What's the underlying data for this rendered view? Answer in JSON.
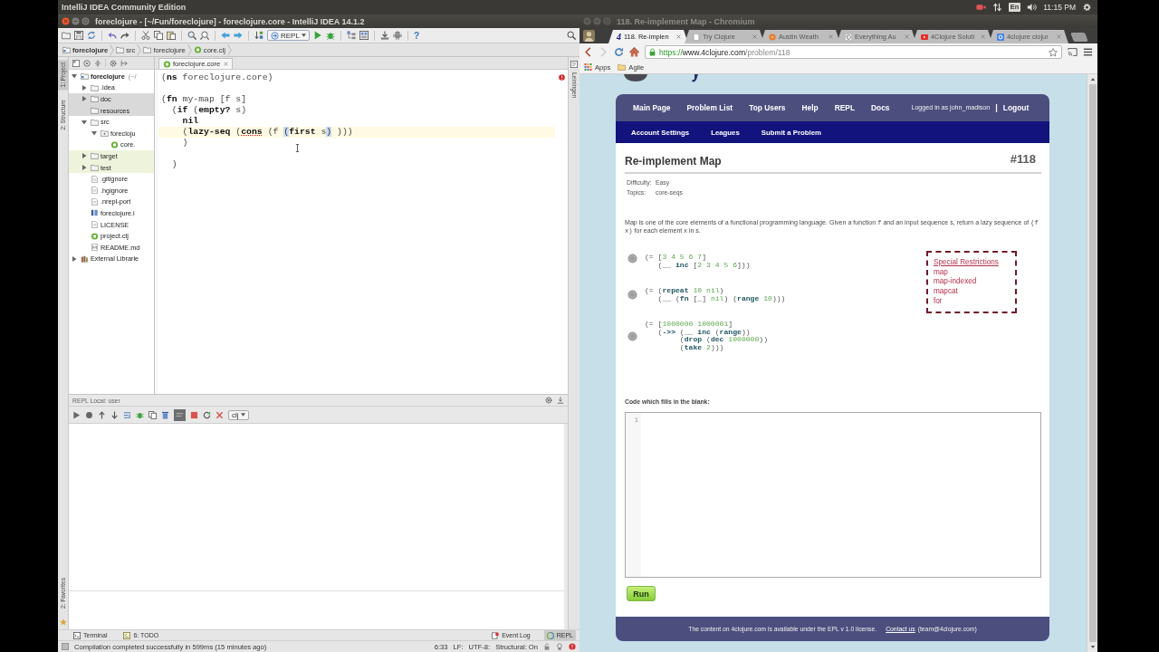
{
  "desktop_bar": {
    "app_name": "IntelliJ IDEA Community Edition",
    "keyboard_layout": "En",
    "clock": "11:15 PM"
  },
  "ide": {
    "title": "foreclojure - [~/Fun/foreclojure] - foreclojure.core - IntelliJ IDEA 14.1.2",
    "run_config": "REPL",
    "help": "?",
    "breadcrumbs": [
      {
        "label": "foreclojure",
        "kind": "project"
      },
      {
        "label": "src",
        "kind": "folder"
      },
      {
        "label": "foreclojure",
        "kind": "folder"
      },
      {
        "label": "core.clj",
        "kind": "clj"
      }
    ],
    "left_stripe": [
      {
        "label": "1: Project",
        "selected": true
      },
      {
        "label": "2: Structure",
        "selected": false
      }
    ],
    "favorites_tab": {
      "label": "2: Favorites"
    },
    "right_stripe": {
      "label": "Leiningen"
    },
    "project_tree": [
      {
        "label": "foreclojure",
        "note": "(~/",
        "kind": "project",
        "expanded": true,
        "children": [
          {
            "label": ".idea",
            "kind": "folder",
            "expanded": false
          },
          {
            "label": "doc",
            "kind": "folder",
            "expanded": false,
            "color": "#d9d9d9"
          },
          {
            "label": "resources",
            "kind": "folder",
            "color": "#d9d9d9"
          },
          {
            "label": "src",
            "kind": "folder",
            "expanded": true,
            "children": [
              {
                "label": "forecloju",
                "kind": "package",
                "expanded": true,
                "children": [
                  {
                    "label": "core.",
                    "kind": "clj"
                  }
                ]
              }
            ]
          },
          {
            "label": "target",
            "kind": "folder",
            "expanded": false,
            "color": "#eef4dc"
          },
          {
            "label": "test",
            "kind": "folder",
            "expanded": false,
            "color": "#eef4dc"
          },
          {
            "label": ".gitignore",
            "kind": "file"
          },
          {
            "label": ".hgignore",
            "kind": "file"
          },
          {
            "label": ".nrepl-port",
            "kind": "file"
          },
          {
            "label": "foreclojure.i",
            "kind": "module"
          },
          {
            "label": "LICENSE",
            "kind": "file"
          },
          {
            "label": "project.clj",
            "kind": "clj"
          },
          {
            "label": "README.md",
            "kind": "markdown"
          }
        ]
      },
      {
        "label": "External Librarie",
        "kind": "library",
        "expanded": false
      }
    ],
    "editor_tab": {
      "label": "foreclojure.core"
    },
    "code_lines": [
      {
        "current": false,
        "tokens": [
          {
            "text": "(",
            "kind": "plain"
          },
          {
            "text": "ns",
            "kind": "keyword"
          },
          {
            "text": " foreclojure.core)",
            "kind": "plain"
          }
        ]
      },
      {
        "current": false
      },
      {
        "current": false,
        "tokens": [
          {
            "text": "(",
            "kind": "plain"
          },
          {
            "text": "fn",
            "kind": "keyword"
          },
          {
            "text": " my-map [f s]",
            "kind": "plain"
          }
        ]
      },
      {
        "current": false,
        "tokens": [
          {
            "text": "  (",
            "kind": "plain"
          },
          {
            "text": "if",
            "kind": "keyword"
          },
          {
            "text": " (",
            "kind": "plain"
          },
          {
            "text": "empty?",
            "kind": "keyword"
          },
          {
            "text": " s)",
            "kind": "plain"
          }
        ]
      },
      {
        "current": false,
        "tokens": [
          {
            "text": "    nil",
            "kind": "keyword"
          }
        ]
      },
      {
        "current": true,
        "tokens": [
          {
            "text": "    (",
            "kind": "plain"
          },
          {
            "text": "lazy-seq",
            "kind": "keyword"
          },
          {
            "text": " (",
            "kind": "plain"
          },
          {
            "text": "cons",
            "kind": "keyword-flagged"
          },
          {
            "text": " (f ",
            "kind": "plain"
          },
          {
            "text": "(",
            "kind": "match"
          },
          {
            "text": "first",
            "kind": "keyword"
          },
          {
            "text": " s",
            "kind": "plain"
          },
          {
            "text": ")",
            "kind": "match"
          },
          {
            "text": " )))",
            "kind": "plain"
          }
        ]
      },
      {
        "current": false,
        "tokens": [
          {
            "text": "    )",
            "kind": "plain"
          }
        ]
      },
      {
        "current": false
      },
      {
        "current": false,
        "tokens": [
          {
            "text": "  )",
            "kind": "plain"
          }
        ]
      }
    ],
    "repl": {
      "title": "REPL Local: user",
      "toggle_on": true,
      "language": "clj"
    },
    "bottom_tabs": [
      {
        "label": "Terminal",
        "kind": "terminal",
        "selected": false
      },
      {
        "label": "6: TODO",
        "kind": "todo",
        "selected": false
      }
    ],
    "bottom_tabs_right": [
      {
        "label": "Event Log",
        "kind": "log",
        "selected": false
      },
      {
        "label": "REPL",
        "kind": "repl",
        "selected": true
      }
    ],
    "status_bar": {
      "message": "Compilation completed successfully in 599ms (15 minutes ago)",
      "position": "6:33",
      "line_separator": "LF:",
      "encoding": "UTF-8:",
      "structural": "Structural: On"
    }
  },
  "browser": {
    "title": "118. Re-implement Map - Chromium",
    "tabs": [
      {
        "label": "118. Re-implen",
        "kind": "glyph",
        "glyph": "4",
        "selected": true
      },
      {
        "label": "Try Clojure",
        "kind": "page",
        "selected": false
      },
      {
        "label": "Austin Weath",
        "kind": "dot",
        "selected": false
      },
      {
        "label": "Everything Au",
        "kind": "swirl",
        "selected": false
      },
      {
        "label": "4Clojure Soluti",
        "kind": "video",
        "selected": false
      },
      {
        "label": "4clojure clojur",
        "kind": "search",
        "selected": false
      }
    ],
    "url": {
      "scheme": "https://",
      "host": "www.4clojure.com",
      "path": "/problem/118"
    },
    "bookmarks": [
      {
        "label": "Apps",
        "kind": "apps"
      },
      {
        "label": "Agile",
        "kind": "folder"
      }
    ],
    "page": {
      "nav": [
        "Main Page",
        "Problem List",
        "Top Users",
        "Help",
        "REPL",
        "Docs"
      ],
      "login_status": "Logged in as john_madison",
      "separator": "|",
      "logout": "Logout",
      "subnav": [
        "Account Settings",
        "Leagues",
        "Submit a Problem"
      ],
      "problem": {
        "title": "Re-implement Map",
        "number": "#118",
        "meta": [
          {
            "label": "Difficulty:",
            "value": "Easy"
          },
          {
            "label": "Topics:",
            "value": "core-seqs"
          }
        ],
        "description": [
          {
            "text": "Map is one of the core elements of a functional programming language. Given a function ",
            "kind": "text"
          },
          {
            "text": "f",
            "kind": "code"
          },
          {
            "text": " and an input sequence s, return a lazy sequence of ",
            "kind": "text"
          },
          {
            "text": "(f x)",
            "kind": "code"
          },
          {
            "text": " for each element x in s.",
            "kind": "text"
          }
        ],
        "tests": [
          {
            "passed": false,
            "lines": [
              {
                "tokens": [
                  {
                    "text": "(= [",
                    "kind": "plain"
                  },
                  {
                    "text": "3 4 5 6 7",
                    "kind": "literal"
                  },
                  {
                    "text": "]",
                    "kind": "plain"
                  }
                ]
              },
              {
                "tokens": [
                  {
                    "text": "   (__ ",
                    "kind": "plain"
                  },
                  {
                    "text": "inc",
                    "kind": "keyword"
                  },
                  {
                    "text": " [",
                    "kind": "plain"
                  },
                  {
                    "text": "2 3 4 5 6",
                    "kind": "literal"
                  },
                  {
                    "text": "]))",
                    "kind": "plain"
                  }
                ]
              }
            ]
          },
          {
            "passed": false,
            "lines": [
              {
                "tokens": [
                  {
                    "text": "(= (",
                    "kind": "plain"
                  },
                  {
                    "text": "repeat",
                    "kind": "keyword"
                  },
                  {
                    "text": " 10 nil",
                    "kind": "literal"
                  },
                  {
                    "text": ")",
                    "kind": "plain"
                  }
                ]
              },
              {
                "tokens": [
                  {
                    "text": "   (__ (",
                    "kind": "plain"
                  },
                  {
                    "text": "fn",
                    "kind": "keyword"
                  },
                  {
                    "text": " [_] ",
                    "kind": "plain"
                  },
                  {
                    "text": "nil",
                    "kind": "literal"
                  },
                  {
                    "text": ") (",
                    "kind": "plain"
                  },
                  {
                    "text": "range",
                    "kind": "keyword"
                  },
                  {
                    "text": " 10",
                    "kind": "literal"
                  },
                  {
                    "text": ")))",
                    "kind": "plain"
                  }
                ]
              }
            ]
          },
          {
            "passed": false,
            "lines": [
              {
                "tokens": [
                  {
                    "text": "(= [",
                    "kind": "plain"
                  },
                  {
                    "text": "1000000 1000001",
                    "kind": "literal"
                  },
                  {
                    "text": "]",
                    "kind": "plain"
                  }
                ]
              },
              {
                "tokens": [
                  {
                    "text": "   (",
                    "kind": "plain"
                  },
                  {
                    "text": "->>",
                    "kind": "keyword"
                  },
                  {
                    "text": " (__ ",
                    "kind": "plain"
                  },
                  {
                    "text": "inc",
                    "kind": "keyword"
                  },
                  {
                    "text": " (",
                    "kind": "plain"
                  },
                  {
                    "text": "range",
                    "kind": "keyword"
                  },
                  {
                    "text": "))",
                    "kind": "plain"
                  }
                ]
              },
              {
                "tokens": [
                  {
                    "text": "        (",
                    "kind": "plain"
                  },
                  {
                    "text": "drop",
                    "kind": "keyword"
                  },
                  {
                    "text": " (",
                    "kind": "plain"
                  },
                  {
                    "text": "dec",
                    "kind": "keyword"
                  },
                  {
                    "text": " 1000000",
                    "kind": "literal"
                  },
                  {
                    "text": "))",
                    "kind": "plain"
                  }
                ]
              },
              {
                "tokens": [
                  {
                    "text": "        (",
                    "kind": "plain"
                  },
                  {
                    "text": "take",
                    "kind": "keyword"
                  },
                  {
                    "text": " 2",
                    "kind": "literal"
                  },
                  {
                    "text": ")))",
                    "kind": "plain"
                  }
                ]
              }
            ]
          }
        ],
        "restrictions": {
          "title": "Special Restrictions",
          "items": [
            "map",
            "map-indexed",
            "mapcat",
            "for"
          ]
        },
        "answer_label": "Code which fills in the blank:",
        "answer_line_number": "1",
        "run_button": "Run"
      },
      "footer": {
        "text": "The content on 4clojure.com is available under the EPL v 1.0 license.",
        "contact_link": "Contact us",
        "email": "(team@4clojure.com)"
      }
    }
  }
}
